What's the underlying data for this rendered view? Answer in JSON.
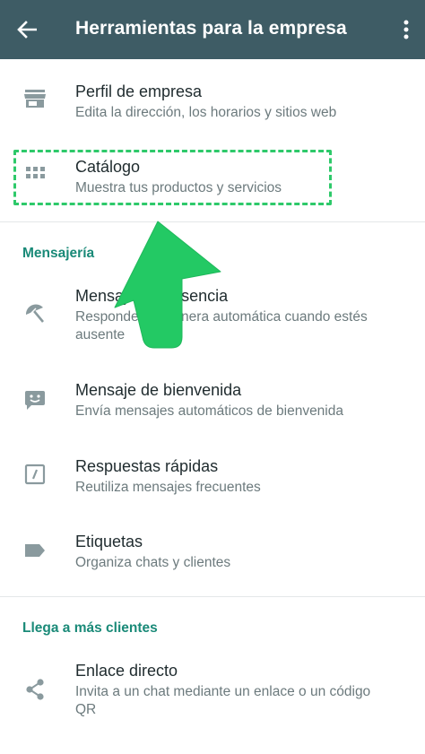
{
  "appbar": {
    "title": "Herramientas para la empresa",
    "back_icon": "arrow-left-icon",
    "more_icon": "more-vert-icon",
    "background": "#3e5c65"
  },
  "items": {
    "perfil": {
      "title": "Perfil de empresa",
      "desc": "Edita la dirección, los horarios y sitios web",
      "icon": "store-icon"
    },
    "catalogo": {
      "title": "Catálogo",
      "desc": "Muestra tus productos y servicios",
      "icon": "grid-icon"
    },
    "ausencia": {
      "title": "Mensaje de ausencia",
      "desc": "Responde de manera automática cuando estés ausente",
      "icon": "beach-umbrella-icon"
    },
    "bienvenida": {
      "title": "Mensaje de bienvenida",
      "desc": "Envía mensajes automáticos de bienvenida",
      "icon": "smiley-chat-icon"
    },
    "respuestas": {
      "title": "Respuestas rápidas",
      "desc": "Reutiliza mensajes frecuentes",
      "icon": "quick-reply-icon"
    },
    "etiquetas": {
      "title": "Etiquetas",
      "desc": "Organiza chats y clientes",
      "icon": "label-icon"
    },
    "enlace": {
      "title": "Enlace directo",
      "desc": "Invita a un chat mediante un enlace o un código QR",
      "icon": "share-icon"
    }
  },
  "sections": {
    "mensajeria": "Mensajería",
    "clientes": "Llega a más clientes"
  },
  "colors": {
    "accent": "#1a8a78",
    "highlight": "#2ec96a",
    "icon": "#8a9a9e"
  }
}
